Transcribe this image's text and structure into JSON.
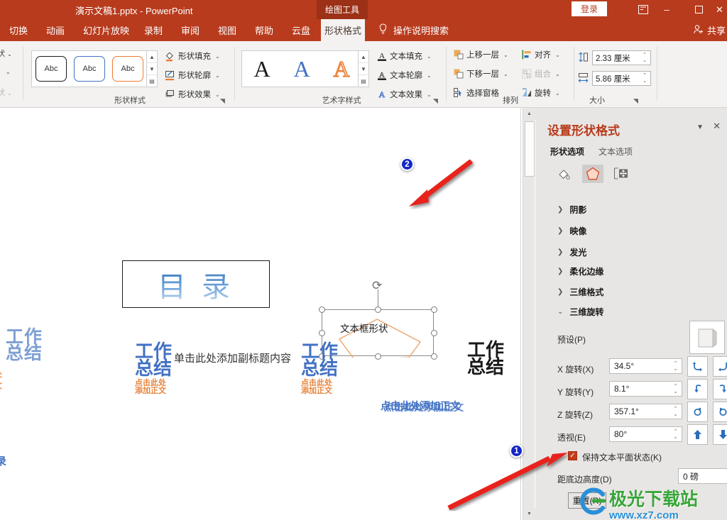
{
  "titlebar": {
    "doc_title": "演示文稿1.pptx  -  PowerPoint",
    "context_tab": "绘图工具",
    "signin": "登录",
    "ribbon_display_icon": "ribbon-display-options-icon",
    "minimize": "–",
    "maximize": "▢",
    "close": "✕"
  },
  "tabs": [
    {
      "label": "切换",
      "active": false
    },
    {
      "label": "动画",
      "active": false
    },
    {
      "label": "幻灯片放映",
      "active": false
    },
    {
      "label": "录制",
      "active": false
    },
    {
      "label": "审阅",
      "active": false
    },
    {
      "label": "视图",
      "active": false
    },
    {
      "label": "帮助",
      "active": false
    },
    {
      "label": "云盘",
      "active": false
    },
    {
      "label": "形状格式",
      "active": true
    }
  ],
  "tellme": {
    "label": "操作说明搜索",
    "icon": "lightbulb-icon"
  },
  "share": {
    "label": "共享",
    "icon": "share-person-icon"
  },
  "ribbon": {
    "cutoff": {
      "item1": "状",
      "item3": "状"
    },
    "shape_styles": {
      "title": "形状样式",
      "gallery": [
        "Abc",
        "Abc",
        "Abc"
      ],
      "commands": [
        {
          "label": "形状填充",
          "icon": "fill-bucket-icon"
        },
        {
          "label": "形状轮廓",
          "icon": "outline-pen-icon"
        },
        {
          "label": "形状效果",
          "icon": "shape-effects-icon"
        }
      ]
    },
    "wordart_styles": {
      "title": "艺术字样式",
      "gallery": [
        "A",
        "A",
        "A"
      ],
      "commands": [
        {
          "label": "文本填充",
          "icon": "text-fill-icon"
        },
        {
          "label": "文本轮廓",
          "icon": "text-outline-icon"
        },
        {
          "label": "文本效果",
          "icon": "text-effects-icon"
        }
      ]
    },
    "arrange": {
      "title": "排列",
      "commands": [
        {
          "label": "上移一层",
          "icon": "bring-forward-icon",
          "disabled": false
        },
        {
          "label": "下移一层",
          "icon": "send-backward-icon",
          "disabled": false
        },
        {
          "label": "选择窗格",
          "icon": "selection-pane-icon",
          "disabled": false
        },
        {
          "label": "对齐",
          "icon": "align-icon",
          "disabled": false
        },
        {
          "label": "组合",
          "icon": "group-icon",
          "disabled": true
        },
        {
          "label": "旋转",
          "icon": "rotate-icon",
          "disabled": false
        }
      ]
    },
    "size": {
      "title": "大小",
      "height": {
        "value": "2.33 厘米",
        "icon": "shape-height-icon"
      },
      "width": {
        "value": "5.86 厘米",
        "icon": "shape-width-icon"
      }
    }
  },
  "slide": {
    "toc_text": "目 录",
    "shape_text": "文本框形状",
    "subtitle": "单击此处添加副标题内容",
    "blocks": [
      {
        "l1": "工作",
        "l2": "总结"
      },
      {
        "l1": "工作",
        "l2": "总结"
      },
      {
        "l1": "工作",
        "l2": "总结"
      },
      {
        "l1": "工作",
        "l2": "总结"
      }
    ],
    "sub_orange_1": "点击此处",
    "sub_orange_2": "添加正文",
    "body_blue": "点击此处添加正文",
    "left_cut": "录"
  },
  "annotations": {
    "badge1": "1",
    "badge2": "2"
  },
  "pane": {
    "title": "设置形状格式",
    "tab_shape": "形状选项",
    "tab_text": "文本选项",
    "icons": [
      {
        "name": "fill-line-icon",
        "selected": false
      },
      {
        "name": "effects-pentagon-icon",
        "selected": true
      },
      {
        "name": "size-properties-icon",
        "selected": false
      }
    ],
    "sections": [
      {
        "label": "阴影",
        "expanded": false
      },
      {
        "label": "映像",
        "expanded": false
      },
      {
        "label": "发光",
        "expanded": false
      },
      {
        "label": "柔化边缘",
        "expanded": false
      },
      {
        "label": "三维格式",
        "expanded": false
      },
      {
        "label": "三维旋转",
        "expanded": true
      }
    ],
    "rotation": {
      "preset_label": "预设(P)",
      "preset_key": "P",
      "fields": [
        {
          "label": "X 旋转(X)",
          "key": "X",
          "value": "34.5°",
          "btn_icon": "rotate-x-icon"
        },
        {
          "label": "Y 旋转(Y)",
          "key": "Y",
          "value": "8.1°",
          "btn_icon": "rotate-y-icon"
        },
        {
          "label": "Z 旋转(Z)",
          "key": "Z",
          "value": "357.1°",
          "btn_icon": "rotate-z-icon"
        },
        {
          "label": "透视(E)",
          "key": "E",
          "value": "80°",
          "btn_icon": "perspective-icon"
        }
      ],
      "keep_text_flat": {
        "label": "保持文本平面状态(K)",
        "key": "K",
        "checked": true
      },
      "distance_from_ground": {
        "label": "距底边高度(D)",
        "key": "D",
        "value": "0 磅"
      },
      "reset": {
        "label": "重置(R)",
        "key": "R"
      }
    }
  },
  "watermark": {
    "main": "极光下载站",
    "sub": "www.xz7.com"
  },
  "colors": {
    "accent_red": "#b83b1d",
    "context_tab": "#9c3117",
    "ribbon_bg": "#f3f2f1",
    "pane_bg": "#e8e6e4",
    "blue_text": "#4272c4",
    "orange_text": "#e8833a",
    "badge_blue": "#1526c8",
    "arrow_red": "#e8201a",
    "shape_outline": "#f0a26a"
  }
}
